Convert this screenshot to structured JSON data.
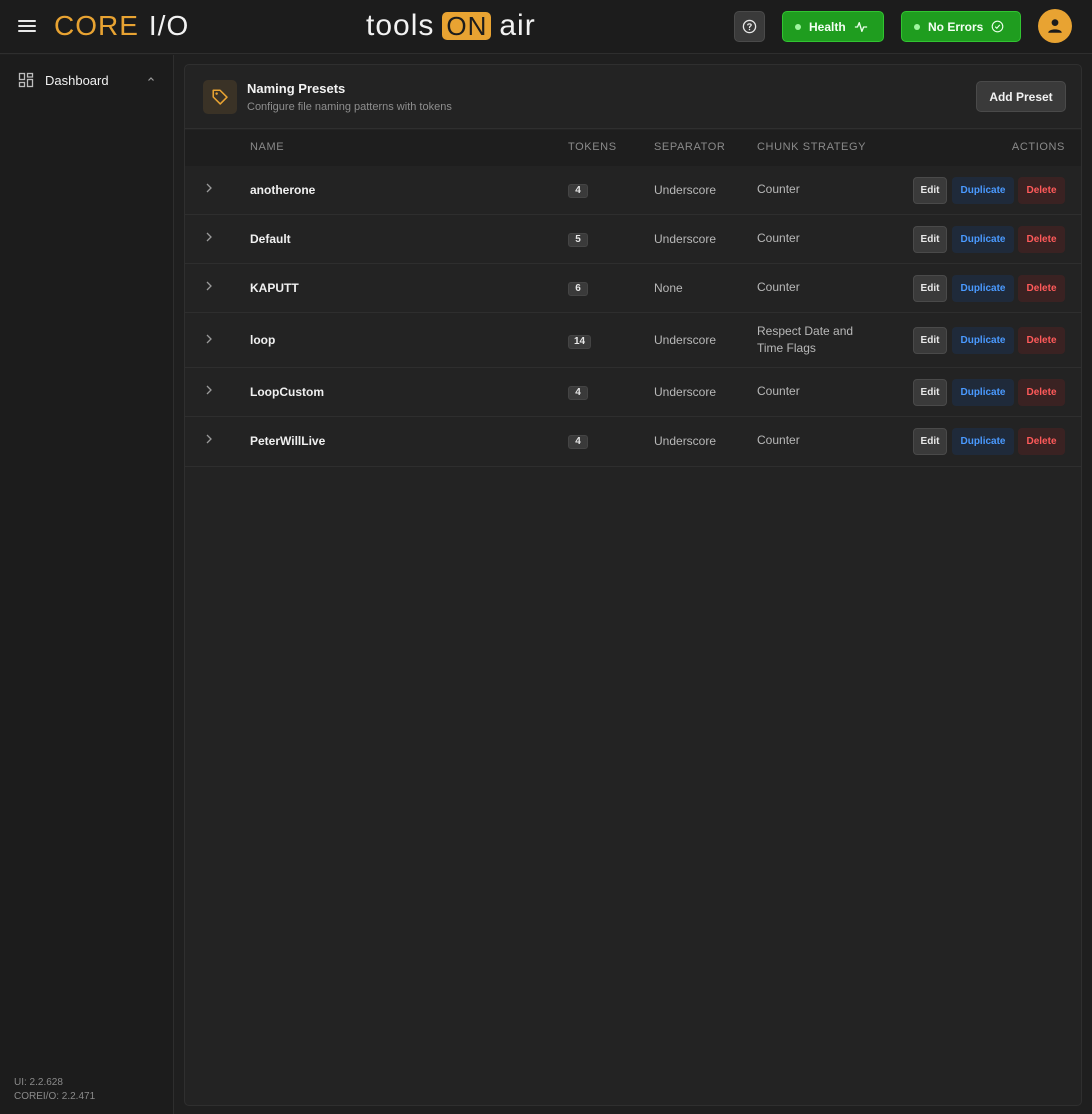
{
  "header": {
    "core_logo": "CORE",
    "core_io": "I/O",
    "brand_left": "tools",
    "brand_on": "ON",
    "brand_right": "air",
    "health_label": "Health",
    "errors_label": "No Errors"
  },
  "sidebar": {
    "items": [
      {
        "label": "Dashboard"
      }
    ],
    "ui_version": "UI: 2.2.628",
    "core_version": "COREI/O: 2.2.471"
  },
  "panel": {
    "title": "Naming Presets",
    "subtitle": "Configure file naming patterns with tokens",
    "add_label": "Add Preset",
    "columns": {
      "name": "NAME",
      "tokens": "TOKENS",
      "separator": "SEPARATOR",
      "chunk": "CHUNK STRATEGY",
      "actions": "ACTIONS"
    },
    "action_labels": {
      "edit": "Edit",
      "duplicate": "Duplicate",
      "delete": "Delete"
    },
    "rows": [
      {
        "name": "anotherone",
        "tokens": "4",
        "separator": "Underscore",
        "chunk": "Counter"
      },
      {
        "name": "Default",
        "tokens": "5",
        "separator": "Underscore",
        "chunk": "Counter"
      },
      {
        "name": "KAPUTT",
        "tokens": "6",
        "separator": "None",
        "chunk": "Counter"
      },
      {
        "name": "loop",
        "tokens": "14",
        "separator": "Underscore",
        "chunk": "Respect Date and Time Flags"
      },
      {
        "name": "LoopCustom",
        "tokens": "4",
        "separator": "Underscore",
        "chunk": "Counter"
      },
      {
        "name": "PeterWillLive",
        "tokens": "4",
        "separator": "Underscore",
        "chunk": "Counter"
      }
    ]
  },
  "colors": {
    "accent": "#e8a332",
    "status_green": "#1f9d1f",
    "duplicate_blue": "#4a9aff",
    "delete_red": "#ff5a5a"
  }
}
